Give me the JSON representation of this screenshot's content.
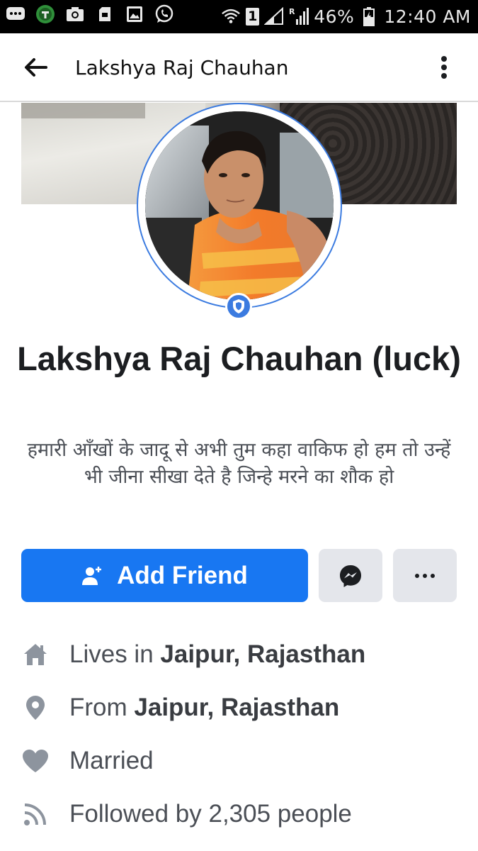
{
  "status_bar": {
    "battery": "46%",
    "time": "12:40 AM",
    "sim": "1",
    "network": "R",
    "icons": [
      "message-icon",
      "app-icon",
      "camera-icon",
      "sd-card-icon",
      "gallery-icon",
      "whatsapp-icon",
      "wifi-icon",
      "signal-icon",
      "battery-icon"
    ]
  },
  "app_bar": {
    "title": "Lakshya Raj Chauhan"
  },
  "profile": {
    "name": "Lakshya Raj Chauhan (luck)",
    "bio": "हमारी आँखों के जादू से अभी तुम कहा वाकिफ हो हम तो उन्हें भी जीना सीखा देते है जिन्हे मरने का शौक हो"
  },
  "actions": {
    "add_friend_label": "Add Friend"
  },
  "intro": {
    "lives_prefix": "Lives in",
    "lives_place": "Jaipur, Rajasthan",
    "from_prefix": "From",
    "from_place": "Jaipur, Rajasthan",
    "relationship": "Married",
    "followers": "Followed by 2,305 people"
  },
  "colors": {
    "primary": "#1877f2",
    "secondary_button": "#e4e6eb",
    "profile_ring": "#3b7be0",
    "text": "#1c1e21",
    "icon_gray": "#8d949e"
  }
}
